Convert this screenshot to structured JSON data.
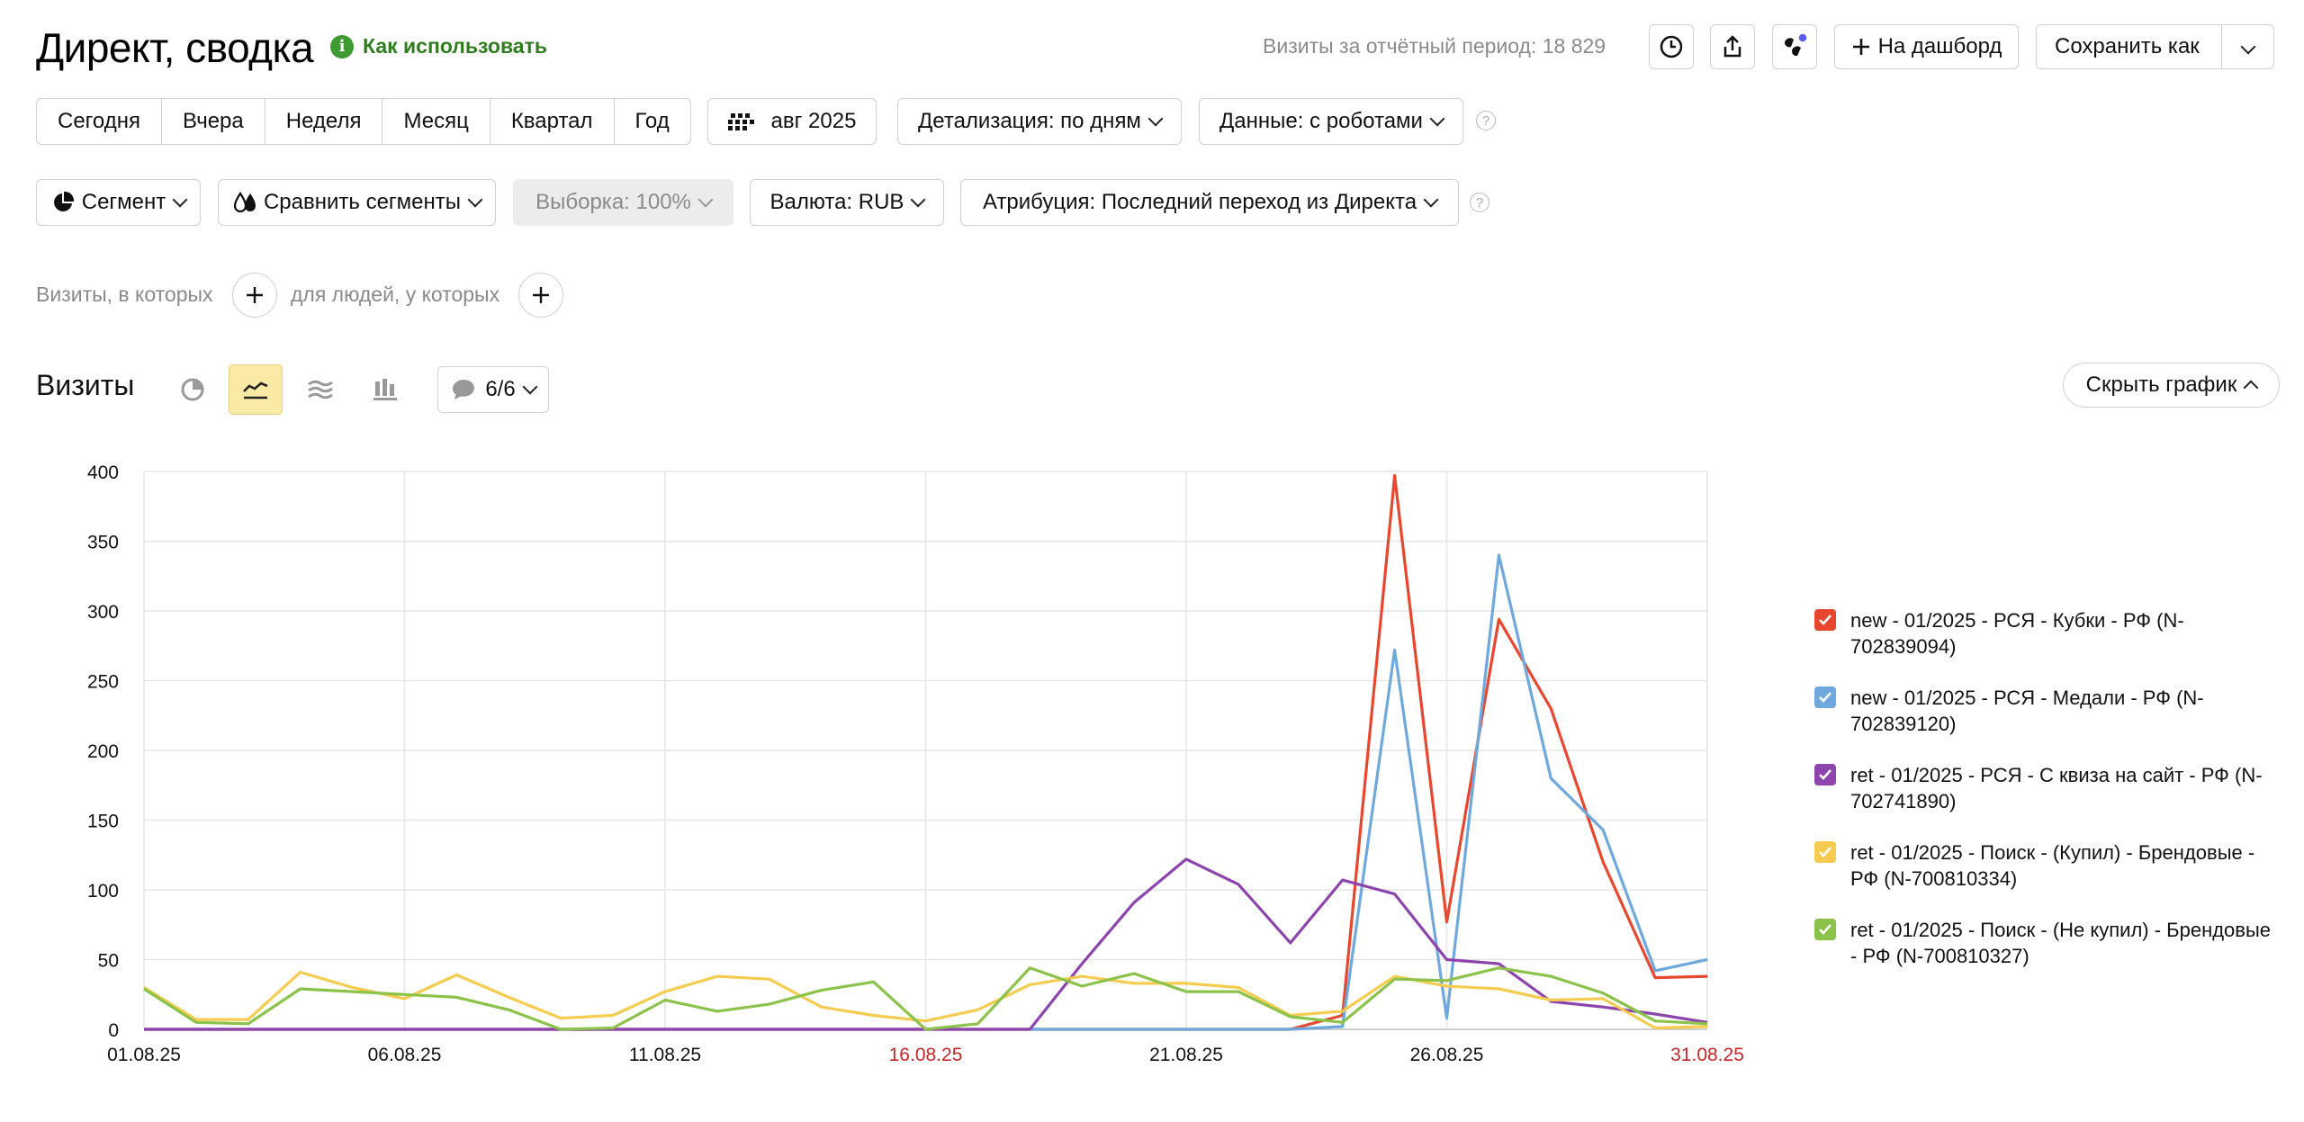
{
  "header": {
    "title": "Директ, сводка",
    "howto": "Как использовать",
    "visits_total": "Визиты за отчётный период: 18 829",
    "add_dashboard": "На дашборд",
    "save_as": "Сохранить как"
  },
  "periods": [
    "Сегодня",
    "Вчера",
    "Неделя",
    "Месяц",
    "Квартал",
    "Год"
  ],
  "toolbar": {
    "date": "авг 2025",
    "detail": "Детализация: по дням",
    "data": "Данные: с роботами",
    "segment": "Сегмент",
    "compare": "Сравнить сегменты",
    "sample": "Выборка: 100%",
    "currency": "Валюта: RUB",
    "attribution": "Атрибуция: Последний переход из Директа"
  },
  "filters": {
    "visits_where": "Визиты, в которых",
    "people_where": "для людей, у которых"
  },
  "chart_section": {
    "title": "Визиты",
    "series_count": "6/6",
    "hide_chart": "Скрыть график"
  },
  "colors": {
    "accent_green": "#3e9a32",
    "weekend_red": "#c62828",
    "active_view": "#fbe9a6"
  },
  "chart_data": {
    "type": "line",
    "ylim": [
      0,
      400
    ],
    "yticks": [
      0,
      50,
      100,
      150,
      200,
      250,
      300,
      350,
      400
    ],
    "grid": true,
    "legend_placement": "right",
    "x": [
      "01.08.25",
      "02.08.25",
      "03.08.25",
      "04.08.25",
      "05.08.25",
      "06.08.25",
      "07.08.25",
      "08.08.25",
      "09.08.25",
      "10.08.25",
      "11.08.25",
      "12.08.25",
      "13.08.25",
      "14.08.25",
      "15.08.25",
      "16.08.25",
      "17.08.25",
      "18.08.25",
      "19.08.25",
      "20.08.25",
      "21.08.25",
      "22.08.25",
      "23.08.25",
      "24.08.25",
      "25.08.25",
      "26.08.25",
      "27.08.25",
      "28.08.25",
      "29.08.25",
      "30.08.25",
      "31.08.25"
    ],
    "xticks": [
      {
        "label": "01.08.25",
        "index": 0,
        "weekend": false
      },
      {
        "label": "06.08.25",
        "index": 5,
        "weekend": false
      },
      {
        "label": "11.08.25",
        "index": 10,
        "weekend": false
      },
      {
        "label": "16.08.25",
        "index": 15,
        "weekend": true
      },
      {
        "label": "21.08.25",
        "index": 20,
        "weekend": false
      },
      {
        "label": "26.08.25",
        "index": 25,
        "weekend": false
      },
      {
        "label": "31.08.25",
        "index": 30,
        "weekend": true
      }
    ],
    "series": [
      {
        "name": "new - 01/2025 - РСЯ - Кубки - РФ (N-702839094)",
        "color": "#e8472f",
        "values": [
          0,
          0,
          0,
          0,
          0,
          0,
          0,
          0,
          0,
          0,
          0,
          0,
          0,
          0,
          0,
          0,
          0,
          0,
          0,
          0,
          0,
          0,
          0,
          10,
          397,
          77,
          294,
          230,
          120,
          37,
          38
        ]
      },
      {
        "name": "new - 01/2025 - РСЯ - Медали - РФ (N-702839120)",
        "color": "#6fa8dc",
        "values": [
          0,
          0,
          0,
          0,
          0,
          0,
          0,
          0,
          0,
          0,
          0,
          0,
          0,
          0,
          0,
          0,
          0,
          0,
          0,
          0,
          0,
          0,
          0,
          2,
          272,
          8,
          340,
          180,
          143,
          42,
          50
        ]
      },
      {
        "name": "ret - 01/2025 - РСЯ - С квиза на сайт - РФ (N-702741890)",
        "color": "#8e44ad",
        "values": [
          0,
          0,
          0,
          0,
          0,
          0,
          0,
          0,
          0,
          0,
          0,
          0,
          0,
          0,
          0,
          0,
          0,
          0,
          47,
          91,
          122,
          104,
          62,
          107,
          97,
          50,
          47,
          20,
          16,
          11,
          5
        ]
      },
      {
        "name": "ret - 01/2025 - Поиск - (Купил) - Брендовые - РФ (N-700810334)",
        "color": "#f5cc50",
        "values": [
          30,
          7,
          7,
          41,
          30,
          22,
          39,
          23,
          8,
          10,
          27,
          38,
          36,
          16,
          10,
          6,
          14,
          32,
          38,
          33,
          33,
          30,
          10,
          13,
          38,
          31,
          29,
          21,
          22,
          1,
          2
        ]
      },
      {
        "name": "ret - 01/2025 - Поиск - (Не купил) - Брендовые - РФ (N-700810327)",
        "color": "#8bc34a",
        "values": [
          29,
          5,
          4,
          29,
          27,
          25,
          23,
          14,
          0,
          1,
          21,
          13,
          18,
          28,
          34,
          0,
          4,
          44,
          31,
          40,
          27,
          27,
          9,
          5,
          36,
          35,
          44,
          38,
          26,
          6,
          4
        ]
      }
    ]
  }
}
